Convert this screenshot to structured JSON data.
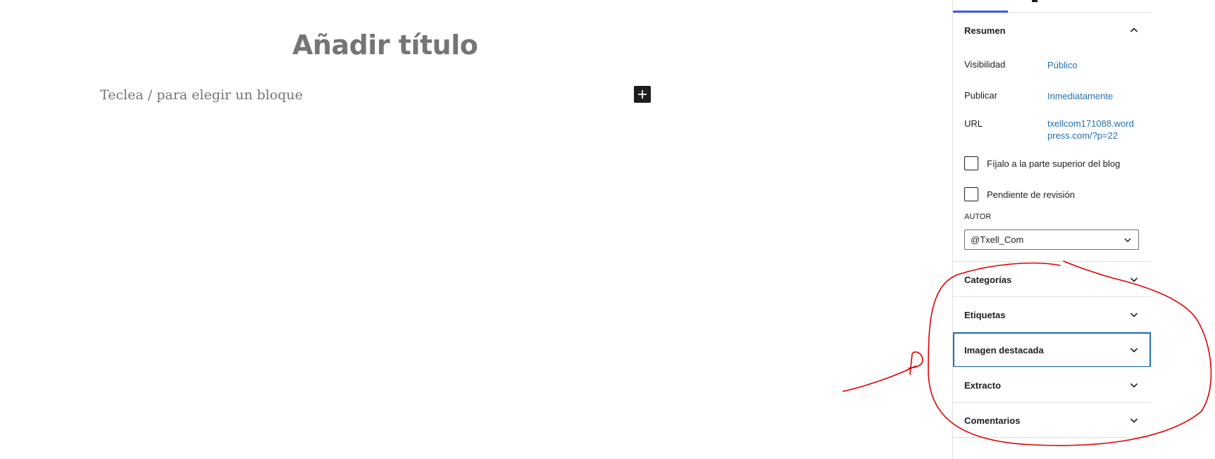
{
  "editor": {
    "title_placeholder": "Añadir título",
    "block_placeholder": "Teclea / para elegir un bloque"
  },
  "sidebar": {
    "summary": {
      "heading": "Resumen",
      "rows": [
        {
          "label": "Visibilidad",
          "value": "Público"
        },
        {
          "label": "Publicar",
          "value": "Inmediatamente"
        },
        {
          "label": "URL",
          "value": "txellcom171088.wordpress.com/?p=22"
        }
      ],
      "checkboxes": [
        {
          "label": "Fíjalo a la parte superior del blog"
        },
        {
          "label": "Pendiente de revisión"
        }
      ],
      "author_label": "AUTOR",
      "author_value": "@Txell_Com"
    },
    "panels": [
      {
        "label": "Categorías"
      },
      {
        "label": "Etiquetas"
      },
      {
        "label": "Imagen destacada"
      },
      {
        "label": "Extracto"
      },
      {
        "label": "Comentarios"
      }
    ]
  },
  "icons": {
    "inserter": "plus-icon",
    "collapse": "chevron-up-icon",
    "expand": "chevron-down-icon"
  },
  "colors": {
    "link": "#2271b1",
    "focus": "#2271b1",
    "annotation": "#e00000",
    "placeholder": "#757575"
  }
}
